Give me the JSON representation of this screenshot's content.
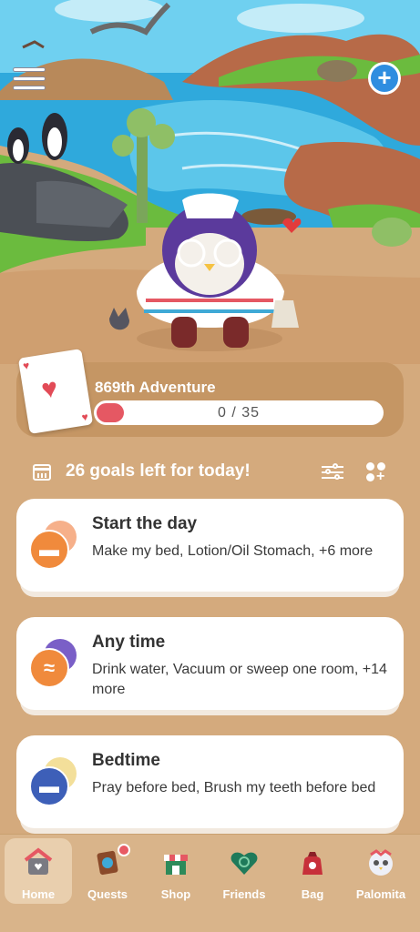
{
  "colors": {
    "background": "#d4aa7d",
    "accent_red": "#e55863",
    "add_button": "#2f8de0"
  },
  "scene": {
    "menu_icon": "hamburger-icon",
    "add_icon": "plus-circle-icon",
    "add_symbol": "+"
  },
  "adventure": {
    "icon": "heart-card-icon",
    "title": "869th Adventure",
    "progress_text": "0 / 35",
    "progress_fraction": 0.0
  },
  "goals": {
    "icon": "calendar-icon",
    "text": "26 goals left for today!",
    "filter_icon": "sliders-icon",
    "add_icon": "grid-plus-icon"
  },
  "routines": [
    {
      "title": "Start the day",
      "subtitle": "Make my bed, Lotion/Oil Stomach, +6 more",
      "icon": "sunrise-bed-icon",
      "front_color": "#f08a3c",
      "back_color": "#f6b08a"
    },
    {
      "title": "Any time",
      "subtitle": "Drink water, Vacuum or sweep one room, +14 more",
      "icon": "wave-icon",
      "front_color": "#f08a3c",
      "back_color": "#7a5fc7"
    },
    {
      "title": "Bedtime",
      "subtitle": "Pray before bed, Brush my teeth before bed",
      "icon": "night-bed-icon",
      "front_color": "#3d5fb8",
      "back_color": "#f3df9a"
    }
  ],
  "nav": {
    "items": [
      {
        "label": "Home",
        "icon": "house-icon",
        "active": true
      },
      {
        "label": "Quests",
        "icon": "scroll-icon",
        "badge": true
      },
      {
        "label": "Shop",
        "icon": "shop-icon"
      },
      {
        "label": "Friends",
        "icon": "friends-heart-icon"
      },
      {
        "label": "Bag",
        "icon": "bag-icon"
      },
      {
        "label": "Palomita",
        "icon": "pet-face-icon"
      }
    ]
  }
}
